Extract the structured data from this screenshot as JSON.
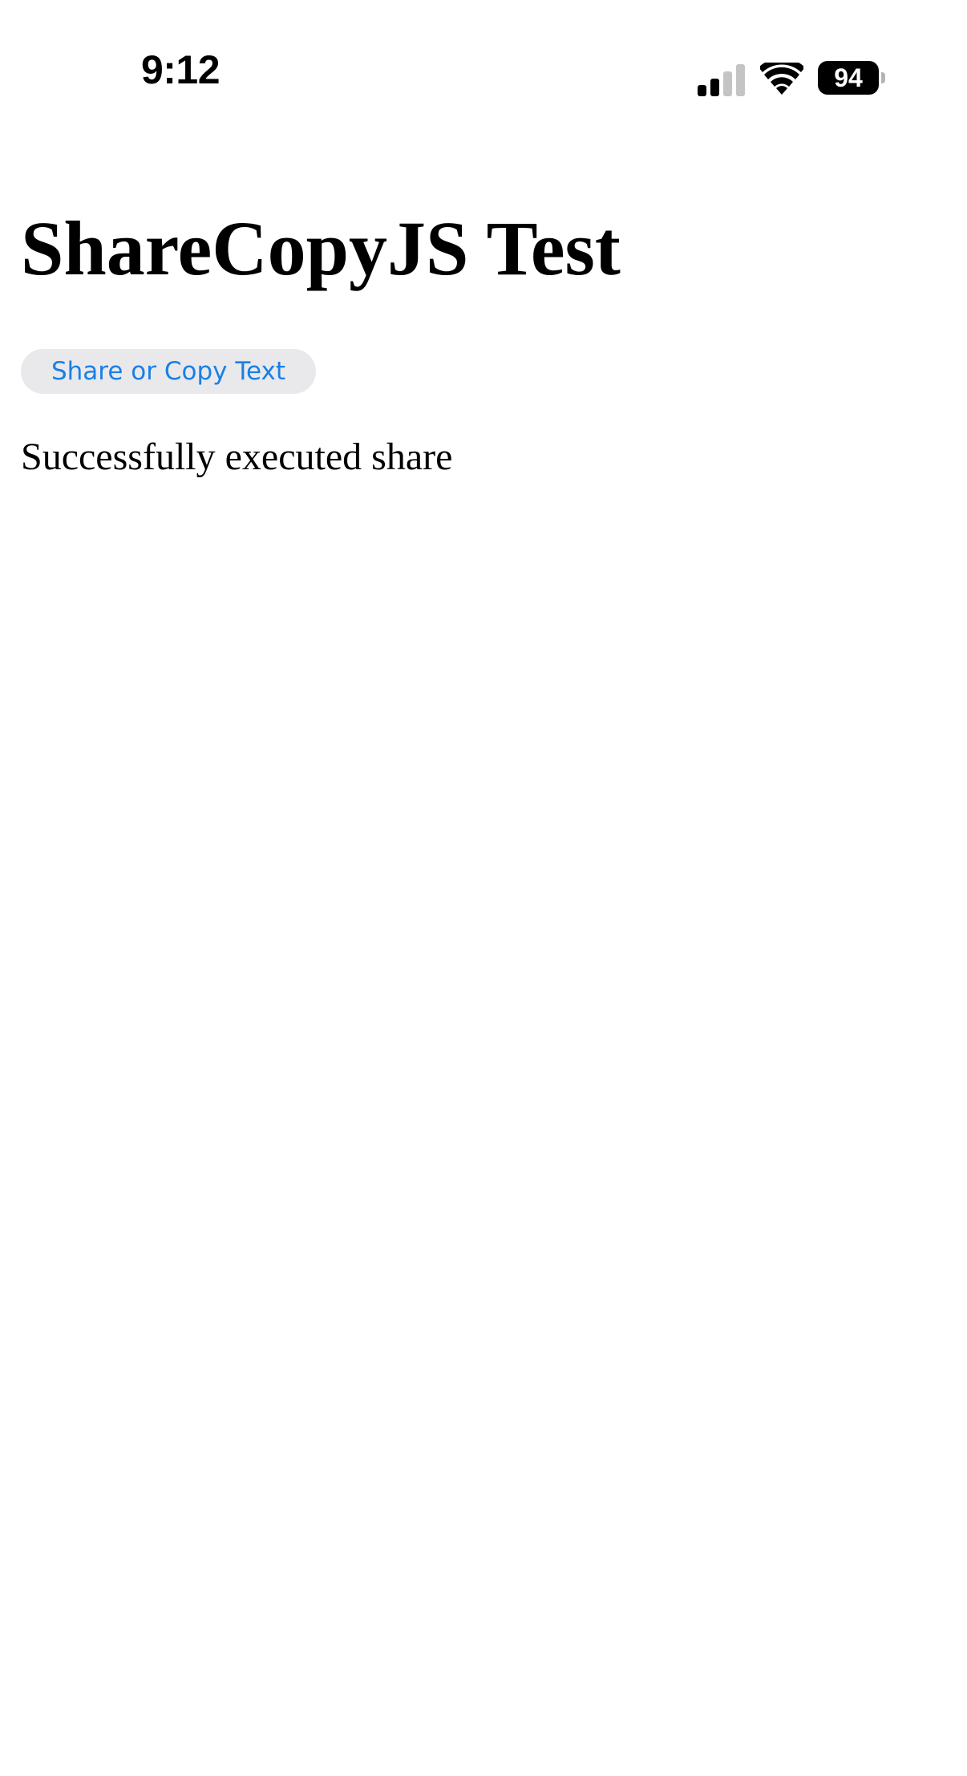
{
  "status_bar": {
    "time": "9:12",
    "battery_level": "94",
    "signal_icon": "cellular-signal-icon",
    "wifi_icon": "wifi-icon",
    "battery_icon": "battery-icon"
  },
  "page": {
    "title": "ShareCopyJS Test",
    "button_label": "Share or Copy Text",
    "result_message": "Successfully executed share"
  },
  "colors": {
    "button_text": "#1a7fe6",
    "button_background": "#e9e9eb"
  }
}
